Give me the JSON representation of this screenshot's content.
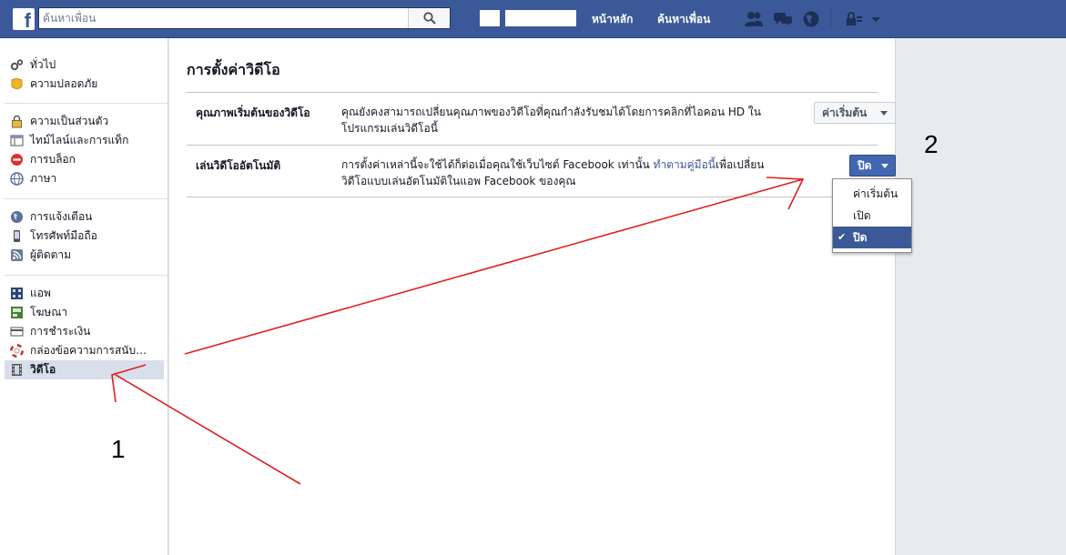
{
  "topbar": {
    "search_placeholder": "ค้นหาเพื่อน",
    "nav_home": "หน้าหลัก",
    "nav_find_friends": "ค้นหาเพื่อน"
  },
  "colors": {
    "brand_blue": "#3b5998",
    "annotation_red": "#e02020"
  },
  "sidebar": {
    "groups": [
      [
        {
          "label": "ทั่วไป",
          "icon": "gear-icon"
        },
        {
          "label": "ความปลอดภัย",
          "icon": "badge-icon"
        }
      ],
      [
        {
          "label": "ความเป็นส่วนตัว",
          "icon": "lock-icon"
        },
        {
          "label": "ไทม์ไลน์และการแท็ก",
          "icon": "timeline-icon"
        },
        {
          "label": "การบล็อก",
          "icon": "block-icon"
        },
        {
          "label": "ภาษา",
          "icon": "globe-icon"
        }
      ],
      [
        {
          "label": "การแจ้งเตือน",
          "icon": "notification-globe-icon"
        },
        {
          "label": "โทรศัพท์มือถือ",
          "icon": "mobile-icon"
        },
        {
          "label": "ผู้ติดตาม",
          "icon": "rss-icon"
        }
      ],
      [
        {
          "label": "แอพ",
          "icon": "apps-icon"
        },
        {
          "label": "โฆษณา",
          "icon": "ads-icon"
        },
        {
          "label": "การชำระเงิน",
          "icon": "payment-icon"
        },
        {
          "label": "กล่องข้อความการสนับ…",
          "icon": "lifebuoy-icon"
        },
        {
          "label": "วิดีโอ",
          "icon": "film-icon",
          "selected": true
        }
      ]
    ]
  },
  "main": {
    "title": "การตั้งค่าวิดีโอ",
    "rows": [
      {
        "label": "คุณภาพเริ่มต้นของวิดีโอ",
        "desc": "คุณยังคงสามารถเปลี่ยนคุณภาพของวิดีโอที่คุณกำลังรับชมได้โดยการคลิกที่ไอคอน HD ในโปรแกรมเล่นวิดีโอนี้",
        "button": "ค่าเริ่มต้น"
      },
      {
        "label": "เล่นวิดีโออัตโนมัติ",
        "desc_pre": "การตั้งค่าเหล่านี้จะใช้ได้ก็ต่อเมื่อคุณใช้เว็บไซต์ Facebook เท่านั้น ",
        "desc_link": "ทำตามคู่มือนี้",
        "desc_post": "เพื่อเปลี่ยนวิดีโอแบบเล่นอัตโนมัติในแอพ Facebook ของคุณ",
        "button": "ปิด"
      }
    ],
    "dropdown": {
      "options": [
        "ค่าเริ่มต้น",
        "เปิด",
        "ปิด"
      ],
      "selected": "ปิด",
      "check": "✔"
    }
  },
  "annotations": {
    "label_1": "1",
    "label_2": "2"
  }
}
